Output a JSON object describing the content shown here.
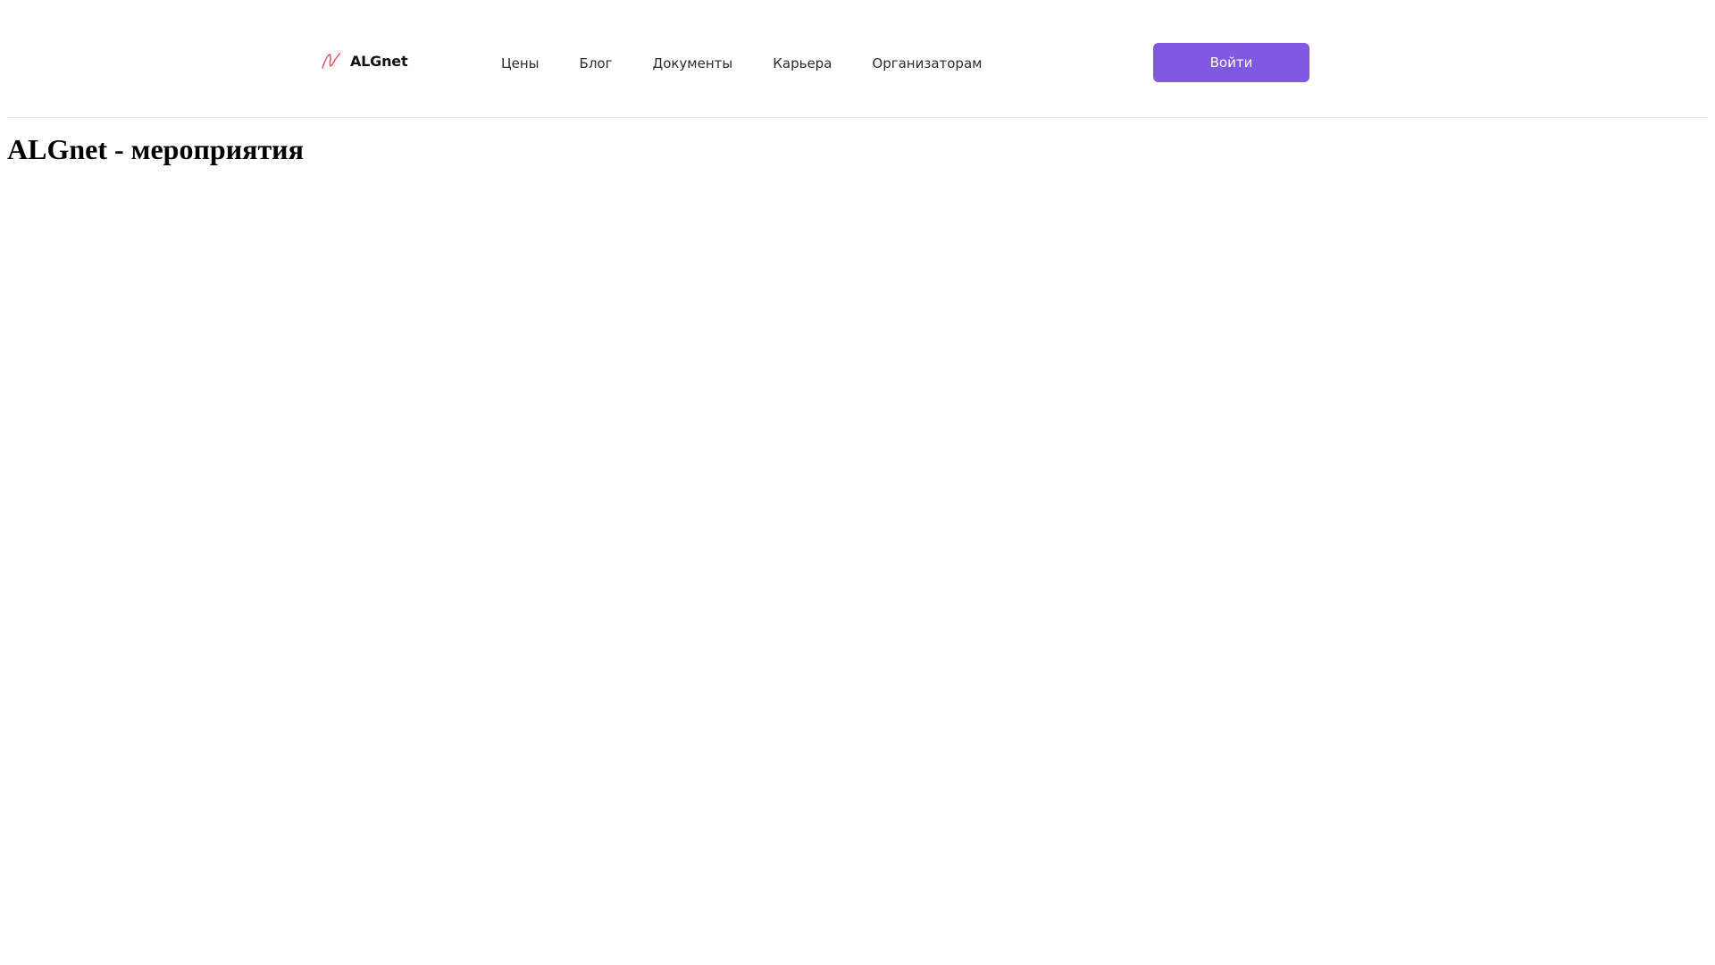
{
  "header": {
    "logo_text": "ALGnet",
    "nav": [
      {
        "label": "Цены"
      },
      {
        "label": "Блог"
      },
      {
        "label": "Документы"
      },
      {
        "label": "Карьера"
      },
      {
        "label": "Организаторам"
      }
    ],
    "login_label": "Войти"
  },
  "main": {
    "title": "ALGnet - мероприятия"
  },
  "colors": {
    "accent": "#8059e0",
    "logo_icon": "#e8475a",
    "divider": "#e6e6e6"
  },
  "icons": {
    "logo": "wave-logo-icon"
  }
}
